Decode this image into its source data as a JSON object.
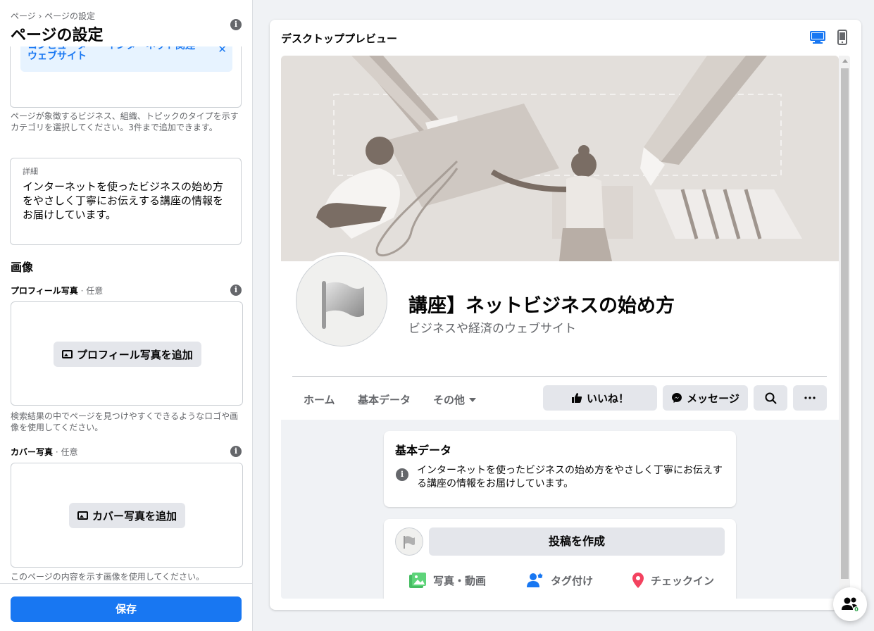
{
  "left_panel": {
    "breadcrumb": "ページ › ページの設定",
    "title": "ページの設定",
    "category_chip": {
      "line1": "コンピューター・インターネット関連",
      "line2": "ウェブサイト"
    },
    "category_help": "ページが象徴するビジネス、組織、トピックのタイプを示すカテゴリを選択してください。3件まで追加できます。",
    "details": {
      "label": "詳細",
      "value": "インターネットを使ったビジネスの始め方をやさしく丁寧にお伝えする講座の情報をお届けしています。"
    },
    "images_heading": "画像",
    "profile_photo": {
      "label": "プロフィール写真",
      "optional": " · 任意",
      "button": "プロフィール写真を追加",
      "help": "検索結果の中でページを見つけやすくできるようなロゴや画像を使用してください。"
    },
    "cover_photo": {
      "label": "カバー写真",
      "optional": " · 任意",
      "button": "カバー写真を追加",
      "help": "このページの内容を示す画像を使用してください。"
    },
    "save_button": "保存"
  },
  "preview": {
    "title": "デスクトッププレビュー",
    "device_icons": [
      "desktop-icon",
      "mobile-icon"
    ],
    "accent_color": "#1877f2",
    "page_name": "講座】ネットビジネスの始め方",
    "page_category": "ビジネスや経済のウェブサイト",
    "tabs": [
      "ホーム",
      "基本データ",
      "その他"
    ],
    "actions": {
      "like": "いいね！",
      "message": "メッセージ"
    },
    "about": {
      "heading": "基本データ",
      "text": "インターネットを使ったビジネスの始め方をやさしく丁寧にお伝えする講座の情報をお届けしています。"
    },
    "composer": {
      "create_post": "投稿を作成",
      "photo_video": "写真・動画",
      "tag": "タグ付け",
      "checkin": "チェックイン"
    }
  },
  "fab_badge": "0"
}
